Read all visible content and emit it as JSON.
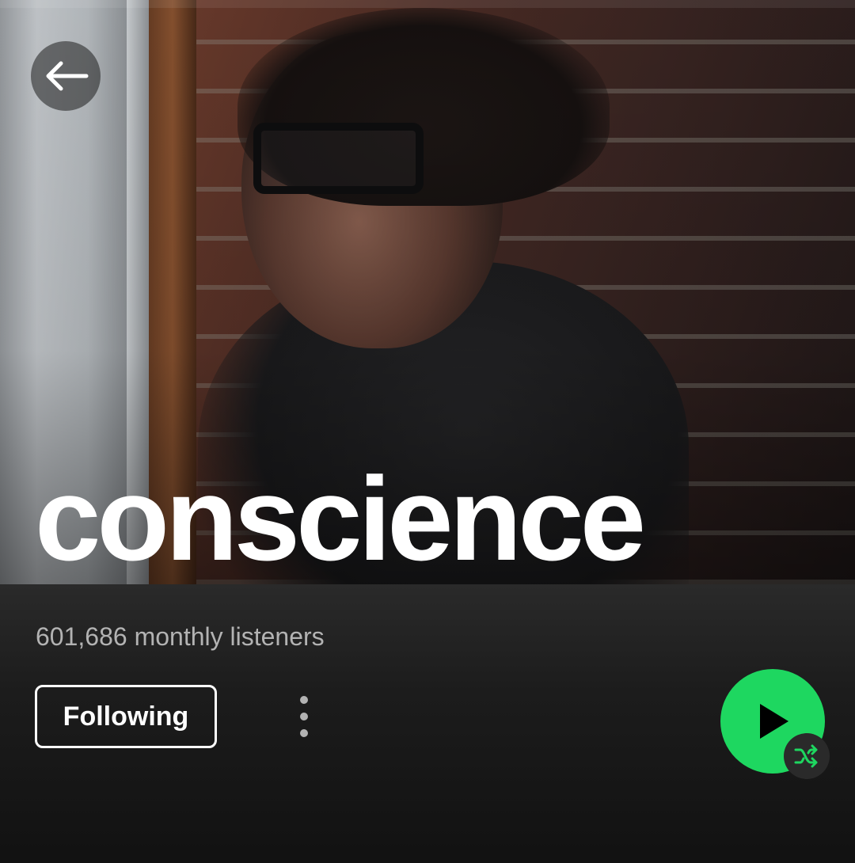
{
  "artist": {
    "name": "conscience",
    "monthly_listeners": "601,686 monthly listeners"
  },
  "actions": {
    "follow_label": "Following"
  },
  "icons": {
    "back": "arrow-left-icon",
    "more": "more-vertical-icon",
    "play": "play-icon",
    "shuffle": "shuffle-icon"
  },
  "colors": {
    "accent": "#1ed760",
    "background": "#121212",
    "text_primary": "#ffffff",
    "text_secondary": "#b3b3b3"
  }
}
